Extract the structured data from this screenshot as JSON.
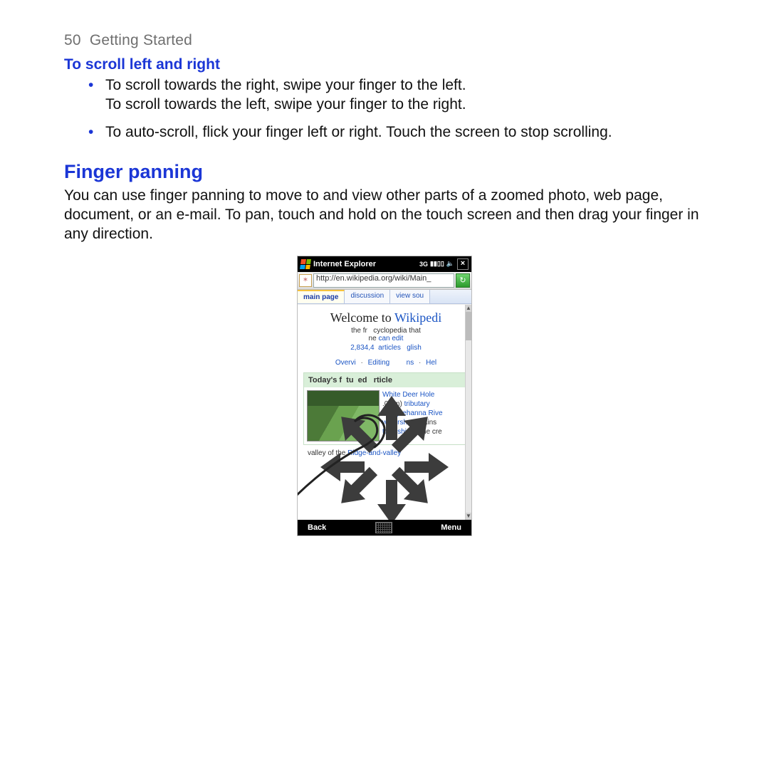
{
  "header": {
    "page_number": "50",
    "section": "Getting Started"
  },
  "scroll_section": {
    "heading": "To scroll left and right",
    "bullets": [
      "To scroll towards the right, swipe your finger to the left.\nTo scroll towards the left, swipe your finger to the right.",
      "To auto-scroll, flick your finger left or right. Touch the screen to stop scrolling."
    ]
  },
  "panning_section": {
    "heading": "Finger panning",
    "body": "You can use finger panning to move to and view other parts of a zoomed photo, web page, document, or an e-mail. To pan, touch and hold on the touch screen and then drag your finger in any direction."
  },
  "screenshot": {
    "titlebar": {
      "app": "Internet Explorer",
      "network": "3G",
      "close": "×"
    },
    "url": "http://en.wikipedia.org/wiki/Main_",
    "tabs": {
      "active": "main page",
      "t2": "discussion",
      "t3": "view sou"
    },
    "wiki": {
      "title_pre": "Welcome to ",
      "title_link": "Wikipedi",
      "sub_pre": "the fr",
      "sub_mid": "cyclopedia",
      "sub_post": " that",
      "sub_line2_a": "ne ",
      "sub_line2_b": "can edit",
      "count": "2,834,4",
      "articles": "articles",
      "lang": "glish",
      "nav1": "Overvi",
      "nav2": "Editing",
      "nav3": "ns",
      "nav4": "Hel",
      "featured_heading_a": "Today's f",
      "featured_heading_b": "tu",
      "featured_heading_c": "ed",
      "featured_heading_d": "rticle",
      "feat_link1": "White Deer Hole",
      "feat_l2a": ".0 km) ",
      "feat_l2b": "tributary",
      "feat_l3": "Susquehanna Rive",
      "feat_l4a": "watershed",
      "feat_l4b": " drains ",
      "feat_l5a": "townships",
      "feat_l5b": ". The cre",
      "tail_a": "valley of the ",
      "tail_b": "Ridge-and-valley"
    },
    "softbar": {
      "left": "Back",
      "right": "Menu"
    }
  }
}
